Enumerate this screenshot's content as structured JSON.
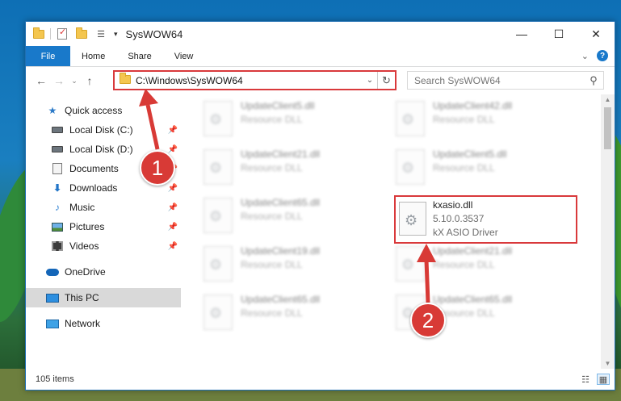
{
  "window": {
    "title": "SysWOW64",
    "controls": {
      "minimize": "—",
      "maximize": "☐",
      "close": "✕"
    }
  },
  "ribbon": {
    "tabs": [
      "File",
      "Home",
      "Share",
      "View"
    ],
    "help": "?"
  },
  "navigation": {
    "back": "←",
    "forward": "→",
    "recent": "⌄",
    "up": "↑",
    "address_path": "C:\\Windows\\SysWOW64",
    "search_placeholder": "Search SysWOW64"
  },
  "sidebar": {
    "quick_access": "Quick access",
    "items": [
      {
        "label": "Local Disk (C:)",
        "icon": "drive-icon",
        "pinned": true
      },
      {
        "label": "Local Disk (D:)",
        "icon": "drive-icon",
        "pinned": true
      },
      {
        "label": "Documents",
        "icon": "documents-icon",
        "pinned": true
      },
      {
        "label": "Downloads",
        "icon": "download-icon",
        "pinned": true
      },
      {
        "label": "Music",
        "icon": "music-icon",
        "pinned": true
      },
      {
        "label": "Pictures",
        "icon": "pictures-icon",
        "pinned": true
      },
      {
        "label": "Videos",
        "icon": "videos-icon",
        "pinned": true
      }
    ],
    "onedrive": "OneDrive",
    "this_pc": "This PC",
    "network": "Network"
  },
  "files": {
    "left_column": [
      {
        "name": "UpdateClient5.dll",
        "desc": "Resource DLL"
      },
      {
        "name": "UpdateClient21.dll",
        "desc": "Resource DLL"
      },
      {
        "name": "UpdateClient65.dll",
        "desc": "Resource DLL"
      },
      {
        "name": "UpdateClient19.dll",
        "desc": "Resource DLL"
      },
      {
        "name": "UpdateClient65.dll",
        "desc": "Resource DLL"
      }
    ],
    "right_column": [
      {
        "name": "UpdateClient42.dll",
        "desc": "Resource DLL"
      },
      {
        "name": "UpdateClient5.dll",
        "desc": "Resource DLL"
      },
      {
        "name": "kxasio.dll",
        "version": "5.10.0.3537",
        "desc": "kX ASIO Driver"
      },
      {
        "name": "UpdateClient21.dll",
        "desc": "Resource DLL"
      },
      {
        "name": "UpdateClient65.dll",
        "desc": "Resource DLL"
      }
    ]
  },
  "status": {
    "item_count": "105 items"
  },
  "callouts": {
    "one": "1",
    "two": "2"
  },
  "colors": {
    "accent": "#1979ca",
    "callout": "#d83a36",
    "highlight_border": "#d9393b"
  }
}
